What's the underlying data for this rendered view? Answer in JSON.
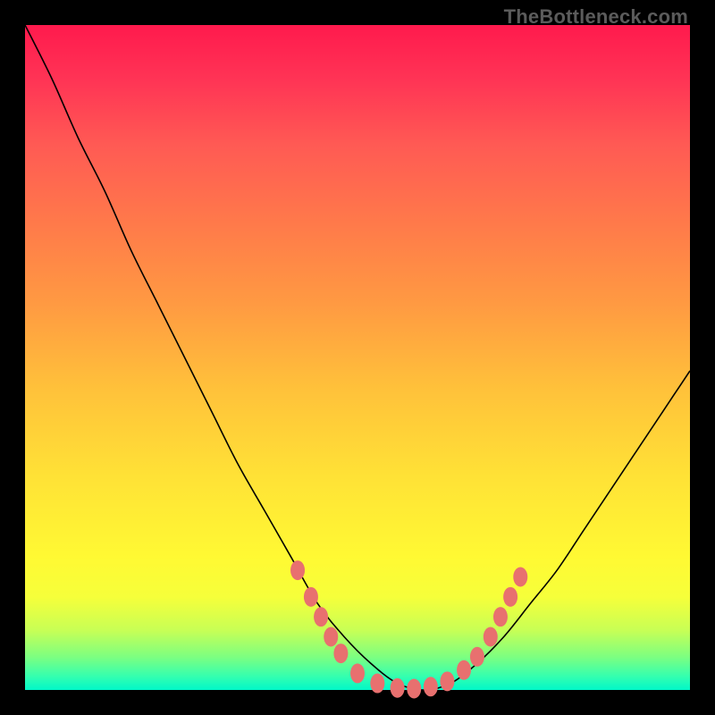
{
  "watermark": "TheBottleneck.com",
  "chart_data": {
    "type": "line",
    "title": "",
    "xlabel": "",
    "ylabel": "",
    "xlim": [
      0,
      100
    ],
    "ylim": [
      0,
      100
    ],
    "background_gradient_stops": [
      {
        "pos": 0,
        "color": "#ff1a4d"
      },
      {
        "pos": 50,
        "color": "#ffd238"
      },
      {
        "pos": 90,
        "color": "#e8ff44"
      },
      {
        "pos": 100,
        "color": "#00f7c8"
      }
    ],
    "series": [
      {
        "name": "bottleneck-curve",
        "x": [
          0,
          4,
          8,
          12,
          16,
          20,
          24,
          28,
          32,
          36,
          40,
          44,
          48,
          52,
          56,
          60,
          64,
          68,
          72,
          76,
          80,
          84,
          88,
          92,
          96,
          100
        ],
        "y": [
          100,
          92,
          83,
          75,
          66,
          58,
          50,
          42,
          34,
          27,
          20,
          13,
          8,
          4,
          1,
          0,
          1,
          4,
          8,
          13,
          18,
          24,
          30,
          36,
          42,
          48
        ]
      }
    ],
    "highlight_dots": {
      "name": "markers",
      "color": "#e8706f",
      "points": [
        {
          "x": 41,
          "y": 18
        },
        {
          "x": 43,
          "y": 14
        },
        {
          "x": 44.5,
          "y": 11
        },
        {
          "x": 46,
          "y": 8
        },
        {
          "x": 47.5,
          "y": 5.5
        },
        {
          "x": 50,
          "y": 2.5
        },
        {
          "x": 53,
          "y": 1
        },
        {
          "x": 56,
          "y": 0.3
        },
        {
          "x": 58.5,
          "y": 0.2
        },
        {
          "x": 61,
          "y": 0.5
        },
        {
          "x": 63.5,
          "y": 1.3
        },
        {
          "x": 66,
          "y": 3
        },
        {
          "x": 68,
          "y": 5
        },
        {
          "x": 70,
          "y": 8
        },
        {
          "x": 71.5,
          "y": 11
        },
        {
          "x": 73,
          "y": 14
        },
        {
          "x": 74.5,
          "y": 17
        }
      ]
    }
  }
}
